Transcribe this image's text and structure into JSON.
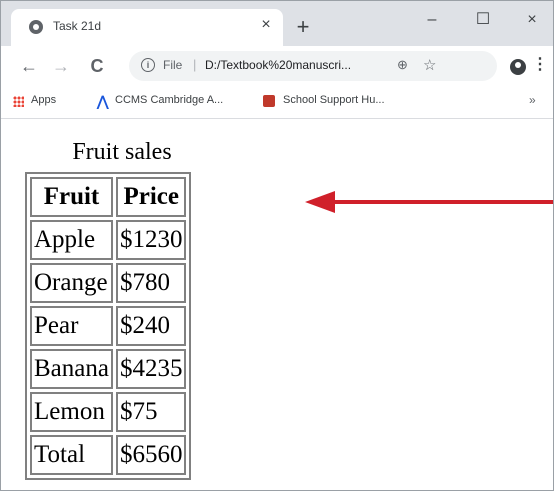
{
  "browser": {
    "tab_title": "Task 21d",
    "tab_close": "×",
    "new_tab": "+",
    "minimize": "–",
    "maximize": "☐",
    "close": "×",
    "back": "←",
    "forward": "→",
    "reload": "C",
    "scheme": "File",
    "url": "D:/Textbook%20manuscri...",
    "menu": "⋮",
    "bookmarks": [
      "Apps",
      "CCMS Cambridge A...",
      "School Support Hu..."
    ],
    "bookmarks_more": "»"
  },
  "page": {
    "caption": "Fruit sales",
    "headers": [
      "Fruit",
      "Price"
    ],
    "rows": [
      [
        "Apple",
        "$1230"
      ],
      [
        "Orange",
        "$780"
      ],
      [
        "Pear",
        "$240"
      ],
      [
        "Banana",
        "$4235"
      ],
      [
        "Lemon",
        "$75"
      ],
      [
        "Total",
        "$6560"
      ]
    ]
  },
  "colors": {
    "arrow": "#d0202a",
    "table_border": "#808080"
  }
}
